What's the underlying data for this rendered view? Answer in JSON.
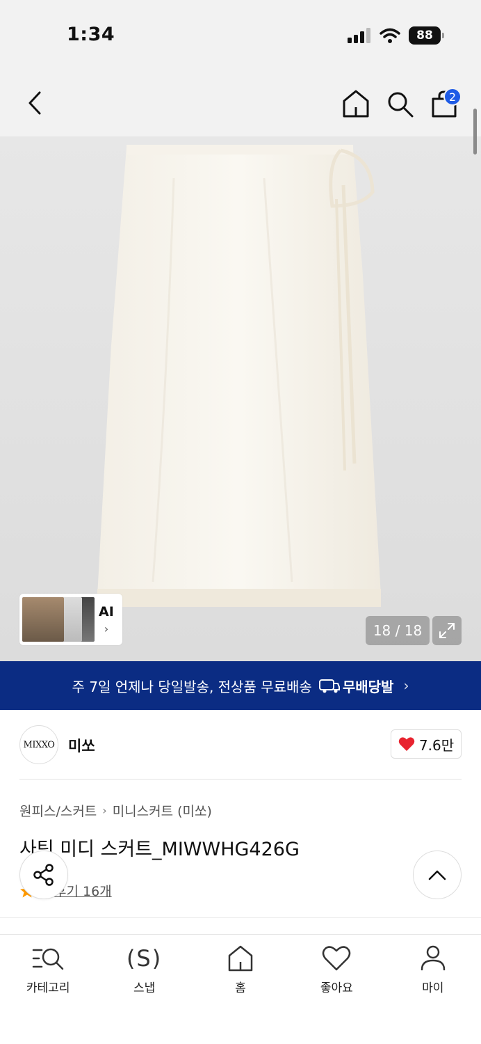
{
  "status_bar": {
    "time": "1:34",
    "battery": "88"
  },
  "nav": {
    "cart_count": "2"
  },
  "gallery": {
    "counter": "18 / 18",
    "ai_label": "AI"
  },
  "promo": {
    "text": "주 7일 언제나 당일발송, 전상품 무료배송",
    "badge_text": "무배당발"
  },
  "brand": {
    "logo_text": "MIXXO",
    "name": "미쏘",
    "likes": "7.6만"
  },
  "product": {
    "breadcrumb": [
      "원피스/스커트",
      "미니스커트 (미쏘)"
    ],
    "title": "사틴 미디 스커트_MIWWHG426G",
    "review_link": "후기 16개"
  },
  "tab_bar": {
    "items": [
      {
        "label": "카테고리",
        "icon": "category-search-icon"
      },
      {
        "label": "스냅",
        "icon": "snap-icon"
      },
      {
        "label": "홈",
        "icon": "home-icon"
      },
      {
        "label": "좋아요",
        "icon": "heart-icon"
      },
      {
        "label": "마이",
        "icon": "person-icon"
      }
    ]
  },
  "colors": {
    "accent_blue": "#1e5be6",
    "banner_navy": "#0b2c83",
    "like_red": "#e8232f",
    "star_orange": "#ff9a00"
  }
}
